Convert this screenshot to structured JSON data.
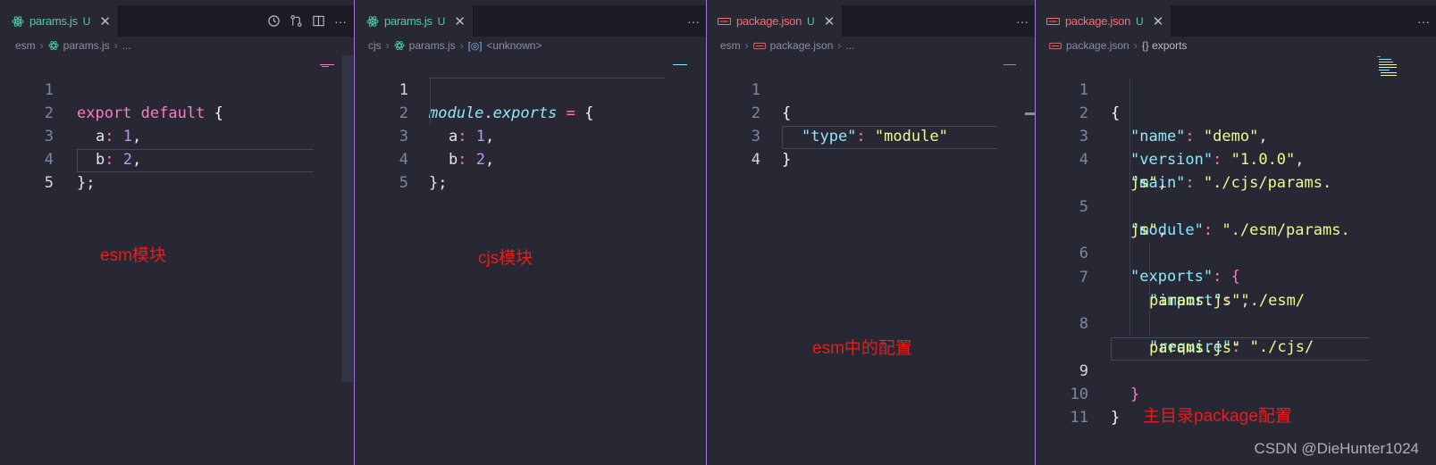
{
  "colors": {
    "editor_bg": "#272833",
    "tab_active_text_js": "#4ec9b0",
    "tab_active_text_json": "#ff6b6b",
    "keyword": "#ff79c6",
    "number": "#bd93f9",
    "string": "#f1fa8c",
    "json_key": "#8be9fd",
    "annotation": "#e02020",
    "pane_divider": "#a177d9"
  },
  "panes": [
    {
      "tab": {
        "icon": "react-icon",
        "name": "params.js",
        "badge": "U"
      },
      "actions": [
        "history-icon",
        "compare-changes-icon",
        "split-editor-icon",
        "more-actions-icon"
      ],
      "breadcrumb": [
        "esm",
        "params.js",
        "..."
      ],
      "lines": [
        "1",
        "2",
        "3",
        "4",
        "5"
      ],
      "annotation": "esm模块"
    },
    {
      "tab": {
        "icon": "react-icon",
        "name": "params.js",
        "badge": "U"
      },
      "actions": [
        "more-actions-icon"
      ],
      "breadcrumb": [
        "cjs",
        "params.js",
        "<unknown>"
      ],
      "lines": [
        "1",
        "2",
        "3",
        "4",
        "5"
      ],
      "annotation": "cjs模块"
    },
    {
      "tab": {
        "icon": "json-icon",
        "name": "package.json",
        "badge": "U"
      },
      "actions": [
        "more-actions-icon"
      ],
      "breadcrumb": [
        "esm",
        "package.json",
        "..."
      ],
      "lines": [
        "1",
        "2",
        "3",
        "4"
      ],
      "annotation": "esm中的配置"
    },
    {
      "tab": {
        "icon": "json-icon",
        "name": "package.json",
        "badge": "U"
      },
      "actions": [
        "more-actions-icon"
      ],
      "breadcrumb": [
        "package.json",
        "{} exports"
      ],
      "lines": [
        "1",
        "2",
        "3",
        "4",
        "",
        "5",
        "",
        "6",
        "7",
        "",
        "8",
        "",
        "9",
        "10",
        "11"
      ],
      "annotation": "主目录package配置"
    }
  ],
  "code": {
    "esm_params": {
      "l1": {
        "kw1": "export",
        "kw2": "default",
        "brace": "{"
      },
      "l2": {
        "prop": "a",
        "colon": ":",
        "num": "1",
        "comma": ","
      },
      "l3": {
        "prop": "b",
        "colon": ":",
        "num": "2",
        "comma": ","
      },
      "l4": {
        "end": "};"
      }
    },
    "cjs_params": {
      "l1": {
        "obj": "module",
        "dot": ".",
        "member": "exports",
        "eq": "=",
        "brace": "{"
      },
      "l2": {
        "prop": "a",
        "colon": ":",
        "num": "1",
        "comma": ","
      },
      "l3": {
        "prop": "b",
        "colon": ":",
        "num": "2",
        "comma": ","
      },
      "l4": {
        "end": "};"
      }
    },
    "esm_package": {
      "l1": "{",
      "l2": {
        "key": "\"type\"",
        "colon": ":",
        "value": "\"module\""
      },
      "l3": "}"
    },
    "root_package": {
      "l1": "{",
      "name": {
        "key": "\"name\"",
        "value": "\"demo\""
      },
      "version": {
        "key": "\"version\"",
        "value": "\"1.0.0\""
      },
      "main": {
        "key": "\"main\"",
        "value_a": "\"./cjs/params.",
        "value_b": "js\""
      },
      "module": {
        "key": "\"module\"",
        "value_a": "\"./esm/params.",
        "value_b": "js\""
      },
      "exports": {
        "key": "\"exports\"",
        "brace": "{"
      },
      "import": {
        "key": "\"import\"",
        "value_a": "\"./esm/",
        "value_b": "params.js\""
      },
      "require": {
        "key": "\"require\"",
        "value_a": "\"./cjs/",
        "value_b": "params.js\""
      },
      "exports_close": "}",
      "close": "}"
    }
  },
  "watermark": "CSDN @DieHunter1024"
}
